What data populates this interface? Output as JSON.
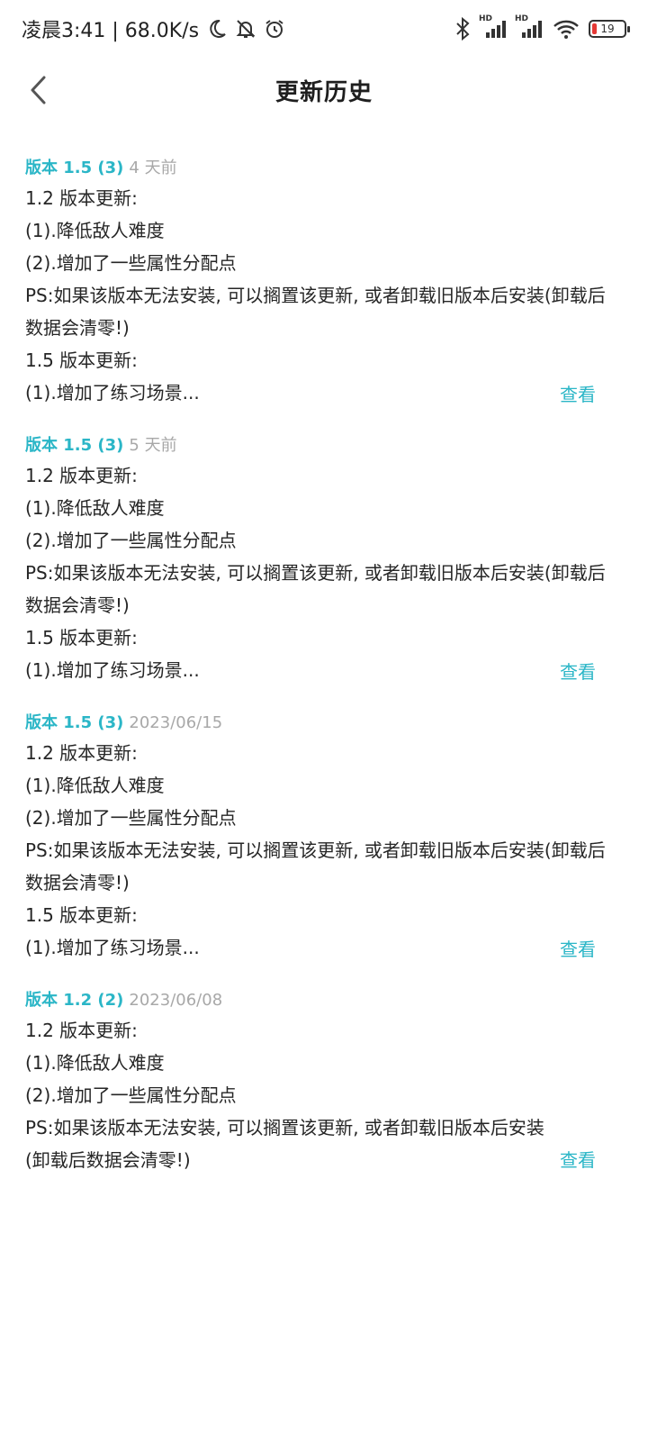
{
  "status": {
    "time_speed": "凌晨3:41 | 68.0K/s",
    "battery": "19",
    "hd1": "HD",
    "hd2": "HD"
  },
  "nav": {
    "title": "更新历史"
  },
  "entries": [
    {
      "version": "版本 1.5 (3)",
      "time": "4 天前",
      "lines": [
        "1.2 版本更新:",
        "(1).降低敌人难度",
        "(2).增加了一些属性分配点",
        "PS:如果该版本无法安装, 可以搁置该更新, 或者卸载旧版本后安装(卸载后数据会清零!)",
        "1.5 版本更新:"
      ],
      "last": "(1).增加了练习场景...",
      "view": "查看"
    },
    {
      "version": "版本 1.5 (3)",
      "time": "5 天前",
      "lines": [
        "1.2 版本更新:",
        "(1).降低敌人难度",
        "(2).增加了一些属性分配点",
        "PS:如果该版本无法安装, 可以搁置该更新, 或者卸载旧版本后安装(卸载后数据会清零!)",
        "1.5 版本更新:"
      ],
      "last": "(1).增加了练习场景...",
      "view": "查看"
    },
    {
      "version": "版本 1.5 (3)",
      "time": "2023/06/15",
      "lines": [
        "1.2 版本更新:",
        "(1).降低敌人难度",
        "(2).增加了一些属性分配点",
        "PS:如果该版本无法安装, 可以搁置该更新, 或者卸载旧版本后安装(卸载后数据会清零!)",
        "1.5 版本更新:"
      ],
      "last": "(1).增加了练习场景...",
      "view": "查看"
    },
    {
      "version": "版本 1.2 (2)",
      "time": "2023/06/08",
      "lines": [
        "1.2 版本更新:",
        "(1).降低敌人难度",
        "(2).增加了一些属性分配点"
      ],
      "last": "PS:如果该版本无法安装, 可以搁置该更新, 或者卸载旧版本后安装(卸载后数据会清零!)",
      "view": "查看"
    }
  ],
  "colors": {
    "accent": "#2bb6c7",
    "muted": "#a8a8a8",
    "battery_low": "#e53935"
  }
}
